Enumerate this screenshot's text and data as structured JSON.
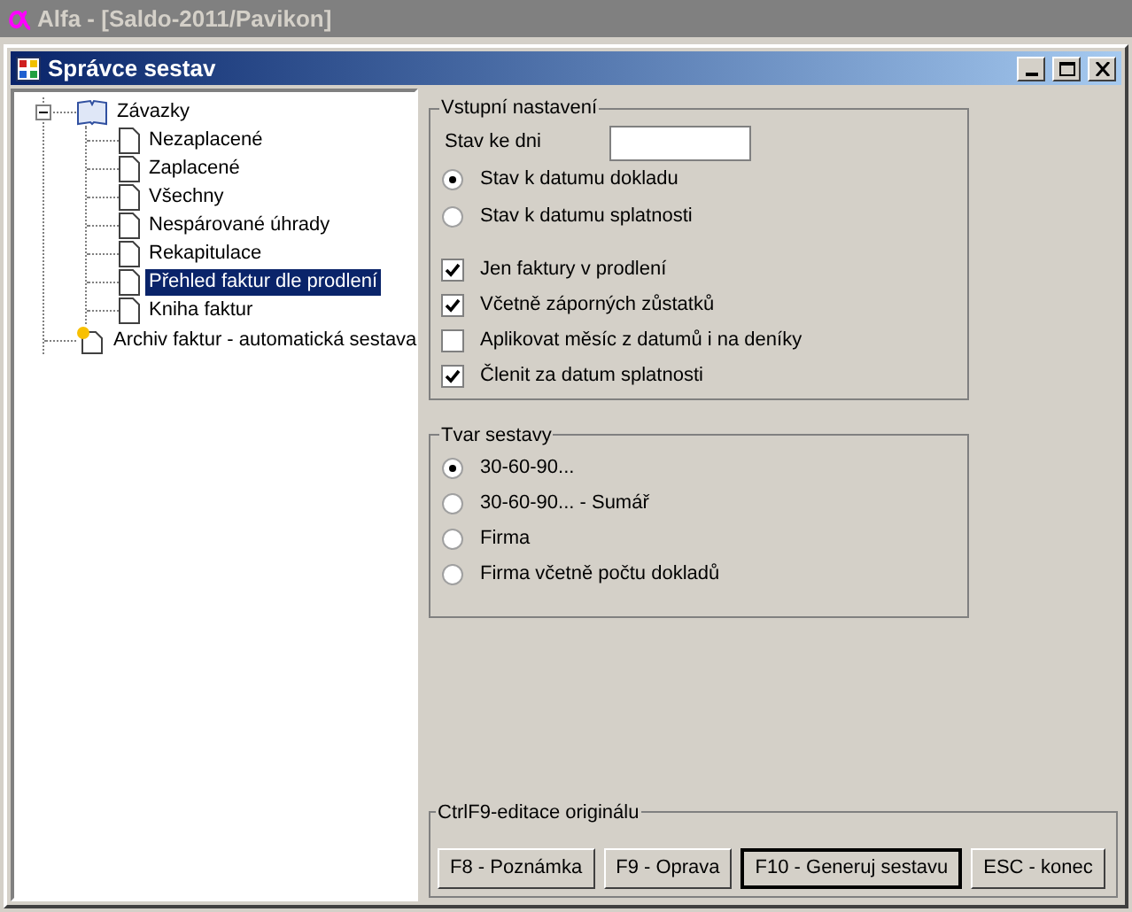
{
  "app_title": "Alfa - [Saldo-2011/Pavikon]",
  "window": {
    "title": "Správce sestav"
  },
  "tree": [
    {
      "label": "Závazky",
      "kind": "folder",
      "expanded": true,
      "selected": false,
      "children": [
        {
          "label": "Nezaplacené",
          "kind": "report",
          "selected": false
        },
        {
          "label": "Zaplacené",
          "kind": "report",
          "selected": false
        },
        {
          "label": "Všechny",
          "kind": "report",
          "selected": false
        },
        {
          "label": "Nespárované úhrady",
          "kind": "report",
          "selected": false
        },
        {
          "label": "Rekapitulace",
          "kind": "report",
          "selected": false
        },
        {
          "label": "Přehled faktur dle prodlení",
          "kind": "report",
          "selected": true
        },
        {
          "label": "Kniha faktur",
          "kind": "report",
          "selected": false
        }
      ]
    },
    {
      "label": "Archiv faktur - automatická sestava",
      "kind": "archive",
      "selected": false
    }
  ],
  "input_settings": {
    "title": "Vstupní nastavení",
    "date_label": "Stav ke dni",
    "radios": [
      {
        "label": "Stav k datumu dokladu",
        "selected": true
      },
      {
        "label": "Stav k datumu splatnosti",
        "selected": false
      }
    ],
    "checkboxes": [
      {
        "label": "Jen faktury v prodlení",
        "checked": true
      },
      {
        "label": "Včetně záporných zůstatků",
        "checked": true
      },
      {
        "label": "Aplikovat měsíc z datumů i na deníky",
        "checked": false
      },
      {
        "label": "Členit za datum splatnosti",
        "checked": true
      }
    ]
  },
  "report_form": {
    "title": "Tvar sestavy",
    "options": [
      {
        "label": "30-60-90...",
        "selected": true
      },
      {
        "label": "30-60-90... - Sumář",
        "selected": false
      },
      {
        "label": "Firma",
        "selected": false
      },
      {
        "label": "Firma včetně počtu dokladů",
        "selected": false
      }
    ]
  },
  "actions": {
    "title": "CtrlF9-editace originálu",
    "buttons": [
      {
        "label": "F8 - Poznámka",
        "default": false
      },
      {
        "label": "F9 - Oprava",
        "default": false
      },
      {
        "label": "F10 - Generuj sestavu",
        "default": true
      },
      {
        "label": "ESC - konec",
        "default": false
      }
    ]
  }
}
